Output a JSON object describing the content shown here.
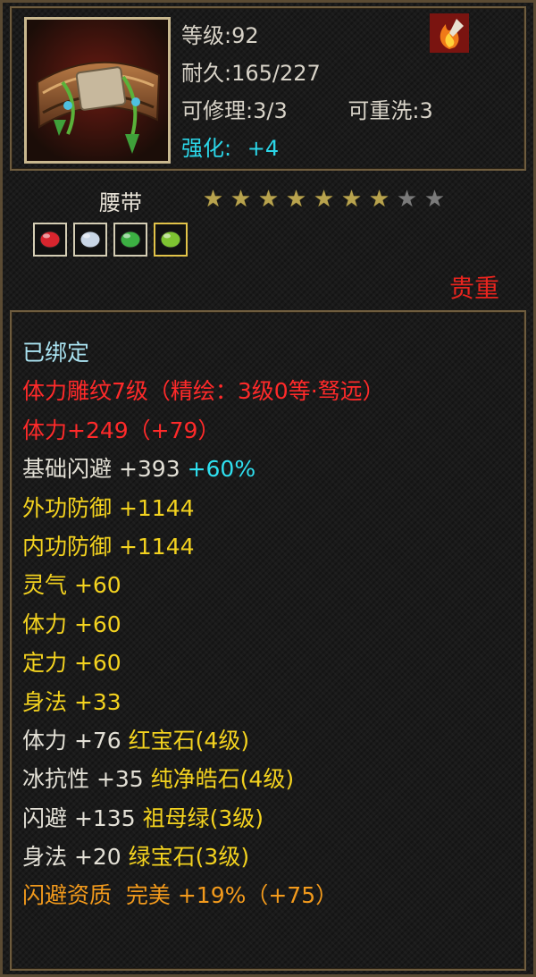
{
  "item": {
    "level": "等级:92",
    "durability": "耐久:165/227",
    "repairable": "可修理:3/3",
    "rewashable": "可重洗:3",
    "enhance_label": "强化:",
    "enhance_value": "+4",
    "name": "腰带",
    "stars": {
      "filled": 7,
      "total": 9
    },
    "rarity": "贵重",
    "icon": "belt-icon"
  },
  "gems": [
    {
      "icon": "ruby-gem-icon",
      "color": "#d8252e"
    },
    {
      "icon": "diamond-gem-icon",
      "color": "#c9d6e6"
    },
    {
      "icon": "emerald-gem-icon",
      "color": "#3cb043"
    },
    {
      "icon": "green-gem-icon",
      "color": "#7ec432"
    }
  ],
  "bound": "已绑定",
  "attributes": [
    {
      "parts": [
        {
          "text": "体力雕纹7级（精绘：3级0等·驽远）",
          "color": "red"
        }
      ]
    },
    {
      "parts": [
        {
          "text": "体力+249（+79）",
          "color": "red"
        }
      ]
    },
    {
      "parts": [
        {
          "text": "基础闪避 +393 ",
          "color": "white"
        },
        {
          "text": "+60%",
          "color": "cyan"
        }
      ]
    },
    {
      "parts": [
        {
          "text": "外功防御 +1144",
          "color": "yellow"
        }
      ]
    },
    {
      "parts": [
        {
          "text": "内功防御 +1144",
          "color": "yellow"
        }
      ]
    },
    {
      "parts": [
        {
          "text": "灵气 +60",
          "color": "yellow"
        }
      ]
    },
    {
      "parts": [
        {
          "text": "体力 +60",
          "color": "yellow"
        }
      ]
    },
    {
      "parts": [
        {
          "text": "定力 +60",
          "color": "yellow"
        }
      ]
    },
    {
      "parts": [
        {
          "text": "身法 +33",
          "color": "yellow"
        }
      ]
    },
    {
      "parts": [
        {
          "text": "体力 +76 ",
          "color": "white"
        },
        {
          "text": "红宝石(4级)",
          "color": "yellow"
        }
      ]
    },
    {
      "parts": [
        {
          "text": "冰抗性 +35 ",
          "color": "white"
        },
        {
          "text": "纯净皓石(4级)",
          "color": "yellow"
        }
      ]
    },
    {
      "parts": [
        {
          "text": "闪避 +135 ",
          "color": "white"
        },
        {
          "text": "祖母绿(3级)",
          "color": "yellow"
        }
      ]
    },
    {
      "parts": [
        {
          "text": "身法 +20 ",
          "color": "white"
        },
        {
          "text": "绿宝石(3级)",
          "color": "yellow"
        }
      ]
    },
    {
      "parts": [
        {
          "text": "闪避资质  完美 +19%（+75）",
          "color": "orange"
        }
      ]
    }
  ],
  "colors": {
    "white": "#e3e0d6",
    "red": "#ff2a2a",
    "yellow": "#f3d21f",
    "cyan": "#2fe0f0",
    "orange": "#f29a1c",
    "bound": "#a9e2f0",
    "rarity": "#e8241e",
    "enhance": "#2bd6e8"
  }
}
